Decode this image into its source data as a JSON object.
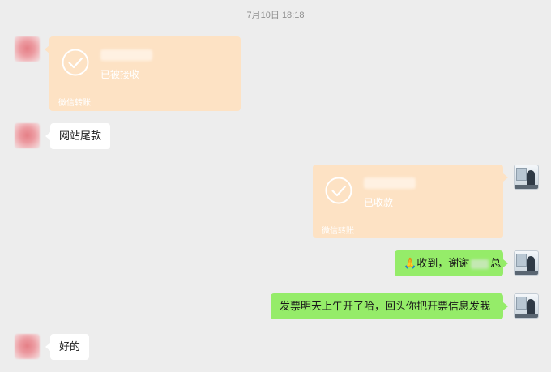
{
  "timestamp": "7月10日 18:18",
  "messages": [
    {
      "sender": "contact",
      "type": "transfer",
      "amount_hidden": true,
      "status": "已被接收",
      "footer": "微信转账"
    },
    {
      "sender": "contact",
      "type": "text",
      "text": "网站尾款"
    },
    {
      "sender": "me",
      "type": "transfer",
      "amount_hidden": true,
      "status": "已收款",
      "footer": "微信转账"
    },
    {
      "sender": "me",
      "type": "text",
      "emoji": "🙏",
      "text_before": "收到，谢谢",
      "text_after": "总",
      "name_hidden": true
    },
    {
      "sender": "me",
      "type": "text",
      "text": "发票明天上午开了哈，回头你把开票信息发我"
    },
    {
      "sender": "contact",
      "type": "text",
      "text": "好的"
    }
  ],
  "colors": {
    "background": "#ededed",
    "transfer_card": "#fde2c4",
    "my_bubble": "#95ec69",
    "their_bubble": "#ffffff"
  }
}
